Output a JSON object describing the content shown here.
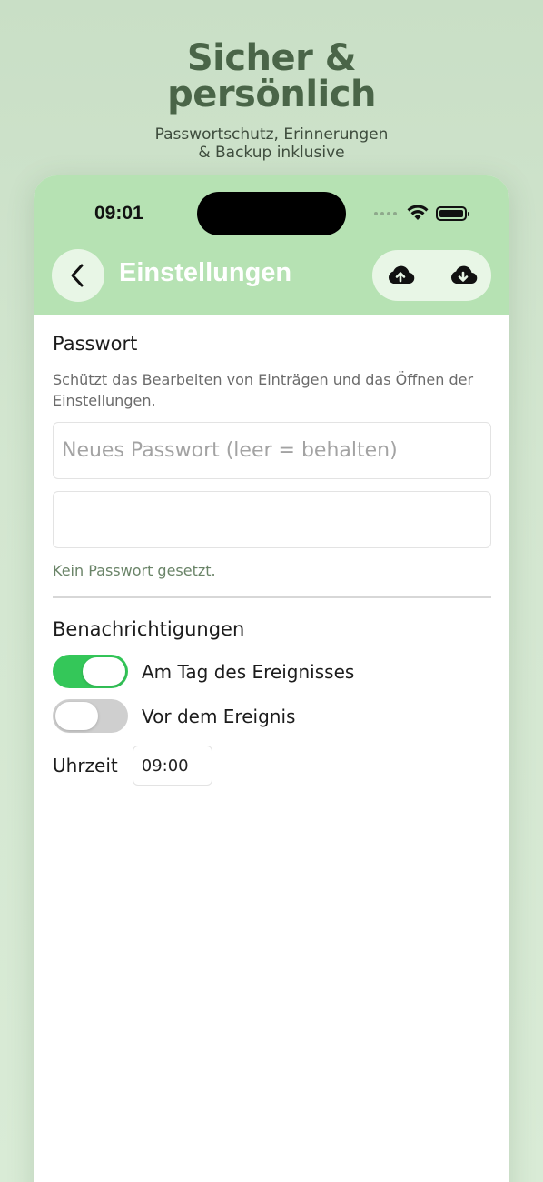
{
  "promo": {
    "title_line1": "Sicher &",
    "title_line2": "persönlich",
    "subtitle_line1": "Passwortschutz, Erinnerungen",
    "subtitle_line2": "& Backup inklusive"
  },
  "status_bar": {
    "time": "09:01",
    "icons": [
      "signal-icon",
      "wifi-icon",
      "battery-icon"
    ]
  },
  "nav": {
    "title": "Einstellungen",
    "back_icon": "chevron-left-icon",
    "actions": [
      "cloud-upload-icon",
      "cloud-download-icon"
    ]
  },
  "password": {
    "title": "Passwort",
    "description": "Schützt das Bearbeiten von Einträgen und das Öffnen der Einstellungen.",
    "new_placeholder": "Neues Passwort (leer = behalten)",
    "confirm_placeholder": "",
    "status": "Kein Passwort gesetzt."
  },
  "notifications": {
    "title": "Benachrichtigungen",
    "on_day_label": "Am Tag des Ereignisses",
    "on_day_enabled": true,
    "before_label": "Vor dem Ereignis",
    "before_enabled": false,
    "time_label": "Uhrzeit",
    "time_value": "09:00"
  },
  "colors": {
    "header_green": "#b6e2b3",
    "toggle_on": "#34c759",
    "promo_title": "#4a6548"
  }
}
